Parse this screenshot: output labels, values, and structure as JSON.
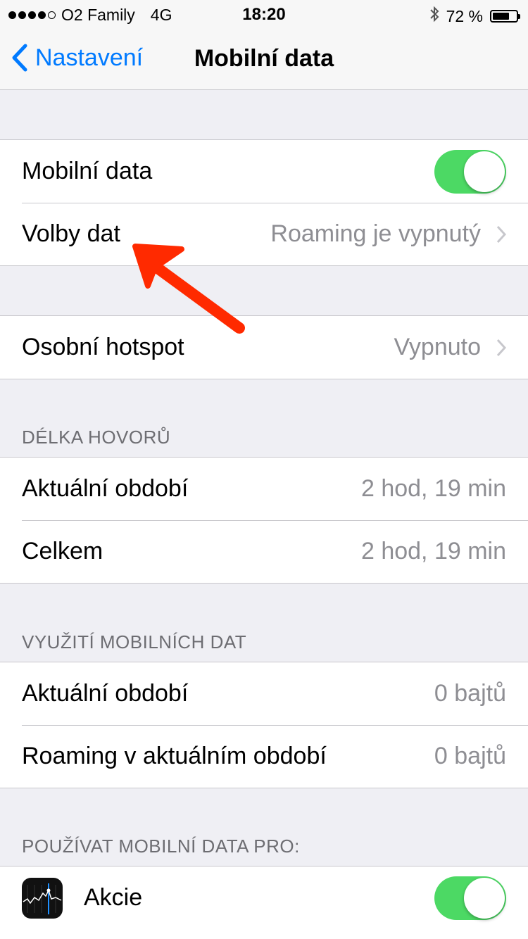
{
  "status_bar": {
    "carrier": "O2 Family",
    "network": "4G",
    "time": "18:20",
    "battery": "72 %",
    "battery_level": 0.72,
    "signal_bars": 4
  },
  "nav": {
    "back_label": "Nastavení",
    "title": "Mobilní data"
  },
  "group1": {
    "mobile_data_label": "Mobilní data",
    "mobile_data_on": true,
    "data_options_label": "Volby dat",
    "data_options_value": "Roaming je vypnutý"
  },
  "group2": {
    "hotspot_label": "Osobní hotspot",
    "hotspot_value": "Vypnuto"
  },
  "call_duration": {
    "header": "DÉLKA HOVORŮ",
    "current_label": "Aktuální období",
    "current_value": "2 hod, 19 min",
    "total_label": "Celkem",
    "total_value": "2 hod, 19 min"
  },
  "data_usage": {
    "header": "VYUŽITÍ MOBILNÍCH DAT",
    "current_label": "Aktuální období",
    "current_value": "0 bajtů",
    "roaming_label": "Roaming v aktuálním období",
    "roaming_value": "0 bajtů"
  },
  "apps": {
    "header": "POUŽÍVAT MOBILNÍ DATA PRO:",
    "items": [
      {
        "name": "Akcie",
        "icon": "stocks-icon",
        "enabled": true
      }
    ]
  },
  "colors": {
    "accent": "#007aff",
    "toggle_on": "#4cd964",
    "annotation_arrow": "#ff2a00"
  }
}
